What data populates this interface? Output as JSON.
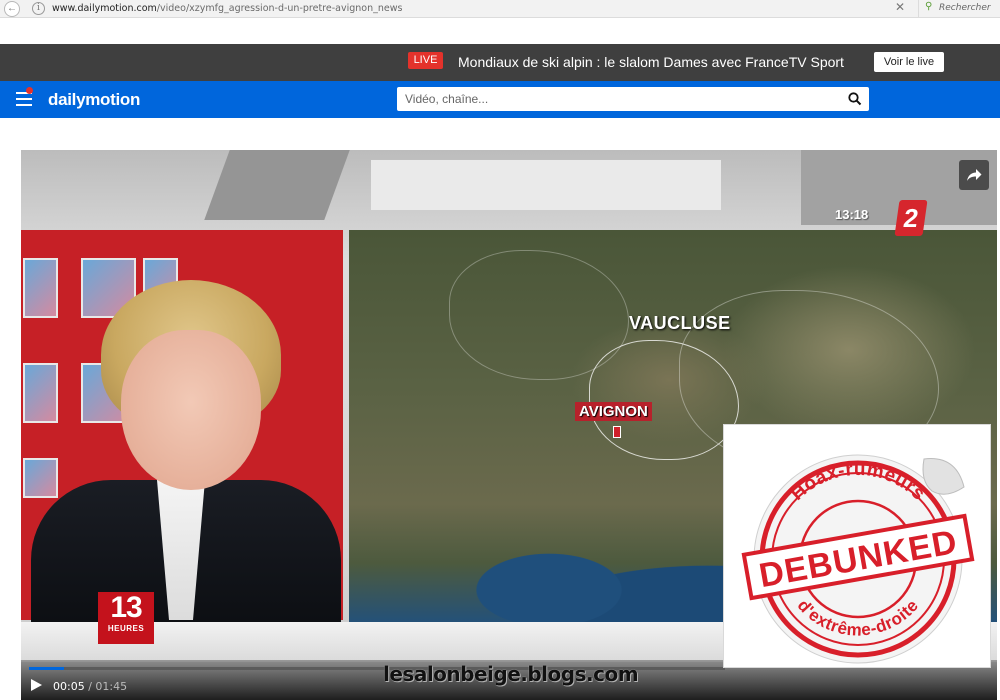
{
  "browser": {
    "url_domain": "www.dailymotion.com",
    "url_path": "/video/xzymfg_agression-d-un-pretre-avignon_news",
    "search_placeholder": "Rechercher"
  },
  "live_bar": {
    "badge": "LIVE",
    "text": "Mondiaux de ski alpin : le slalom Dames avec FranceTV Sport",
    "button": "Voir le live"
  },
  "header": {
    "logo": "dailymotion",
    "search_placeholder": "Vidéo, chaîne..."
  },
  "video": {
    "map_label_region": "VAUCLUSE",
    "map_label_city": "AVIGNON",
    "channel_number": "2",
    "channel_time": "13:18",
    "show_logo_number": "13",
    "show_logo_label": "HEURES",
    "current_time": "00:05",
    "separator": "/",
    "duration": "01:45",
    "progress_fraction": 0.05,
    "watermark": "lesalonbeige.blogs.com"
  },
  "sticker": {
    "top_arc": "Hoax-rumeurs",
    "stamp": "DEBUNKED",
    "bottom_arc": "d'extrême-droite"
  },
  "colors": {
    "brand_blue": "#0066dc",
    "live_red": "#e4322b",
    "stamp_red": "#d81f2a"
  }
}
